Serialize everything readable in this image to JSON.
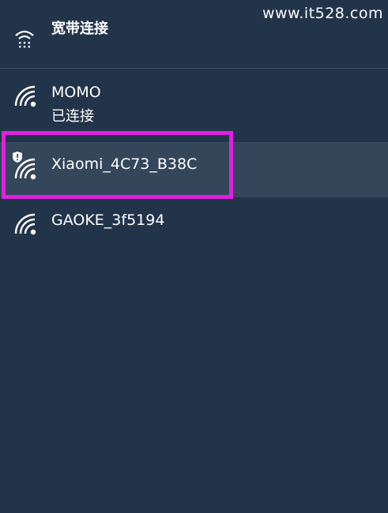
{
  "watermark": "www.it528.com",
  "broadband": {
    "label": "宽带连接",
    "icon": "dialup-icon"
  },
  "networks": [
    {
      "name": "MOMO",
      "status": "已连接",
      "icon": "wifi-icon",
      "secured": false
    },
    {
      "name": "Xiaomi_4C73_B38C",
      "icon": "wifi-secured-icon",
      "secured": true,
      "selected": true
    },
    {
      "name": "GAOKE_3f5194",
      "icon": "wifi-icon",
      "secured": false
    }
  ],
  "colors": {
    "background": "#22344a",
    "selected_row": "#34465a",
    "highlight_border": "#e020e0",
    "text": "#ffffff"
  }
}
